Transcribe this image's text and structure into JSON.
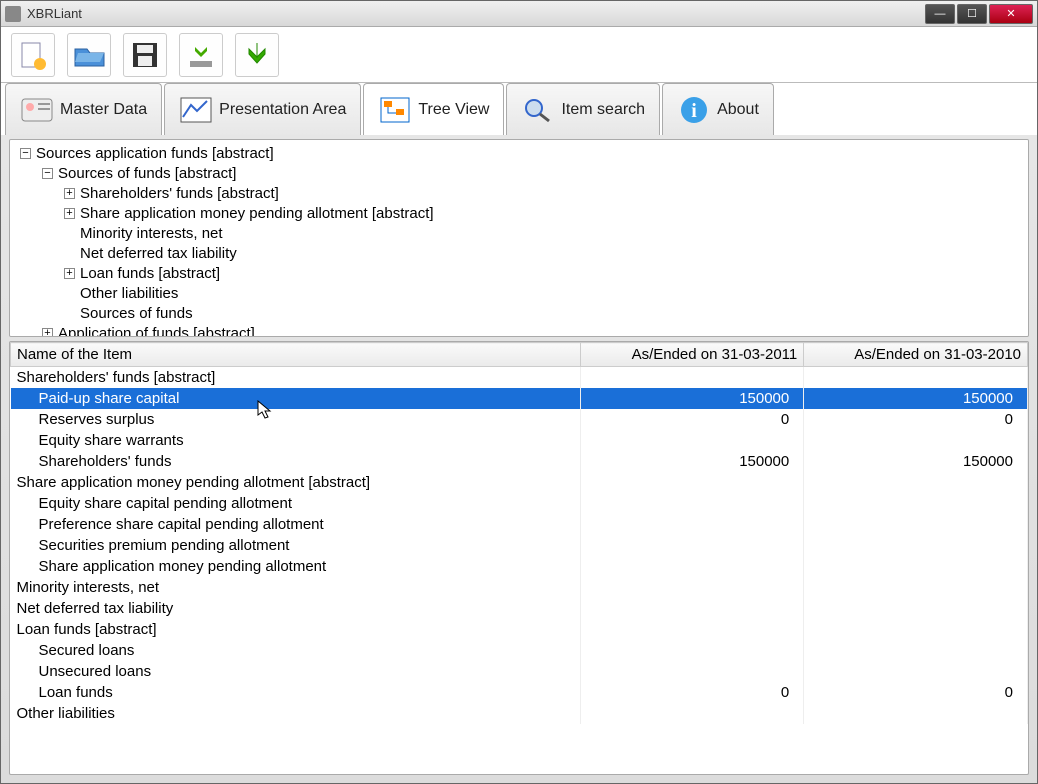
{
  "window": {
    "title": "XBRLiant"
  },
  "toolbar": {
    "buttons": [
      "new",
      "open",
      "save",
      "download",
      "refresh"
    ]
  },
  "tabs": {
    "items": [
      {
        "label": "Master Data"
      },
      {
        "label": "Presentation Area"
      },
      {
        "label": "Tree View"
      },
      {
        "label": "Item search"
      },
      {
        "label": "About"
      }
    ],
    "active": 2
  },
  "tree": {
    "n0": "Sources application funds [abstract]",
    "n1": "Sources of funds [abstract]",
    "n2": "Shareholders' funds [abstract]",
    "n3": "Share application money pending allotment [abstract]",
    "n4": "Minority interests, net",
    "n5": "Net deferred tax liability",
    "n6": "Loan funds [abstract]",
    "n7": "Other liabilities",
    "n8": "Sources of funds",
    "n9": "Application of funds [abstract]"
  },
  "grid": {
    "columns": {
      "c0": "Name of the Item",
      "c1": "As/Ended on 31-03-2011",
      "c2": "As/Ended on 31-03-2010"
    },
    "rows": [
      {
        "name": "Shareholders' funds [abstract]",
        "indent": 0,
        "v1": "",
        "v2": ""
      },
      {
        "name": "Paid-up share capital",
        "indent": 1,
        "v1": "150000",
        "v2": "150000",
        "selected": true
      },
      {
        "name": "Reserves surplus",
        "indent": 1,
        "v1": "0",
        "v2": "0"
      },
      {
        "name": "Equity share warrants",
        "indent": 1,
        "v1": "",
        "v2": ""
      },
      {
        "name": "Shareholders' funds",
        "indent": 1,
        "v1": "150000",
        "v2": "150000"
      },
      {
        "name": "Share application money pending allotment [abstract]",
        "indent": 0,
        "v1": "",
        "v2": ""
      },
      {
        "name": "Equity share capital pending allotment",
        "indent": 1,
        "v1": "",
        "v2": ""
      },
      {
        "name": "Preference share capital pending allotment",
        "indent": 1,
        "v1": "",
        "v2": ""
      },
      {
        "name": "Securities premium pending allotment",
        "indent": 1,
        "v1": "",
        "v2": ""
      },
      {
        "name": "Share application money pending allotment",
        "indent": 1,
        "v1": "",
        "v2": ""
      },
      {
        "name": "Minority interests, net",
        "indent": 0,
        "v1": "",
        "v2": ""
      },
      {
        "name": "Net deferred tax liability",
        "indent": 0,
        "v1": "",
        "v2": ""
      },
      {
        "name": "Loan funds [abstract]",
        "indent": 0,
        "v1": "",
        "v2": ""
      },
      {
        "name": "Secured loans",
        "indent": 1,
        "v1": "",
        "v2": ""
      },
      {
        "name": "Unsecured loans",
        "indent": 1,
        "v1": "",
        "v2": ""
      },
      {
        "name": "Loan funds",
        "indent": 1,
        "v1": "0",
        "v2": "0"
      },
      {
        "name": "Other liabilities",
        "indent": 0,
        "v1": "",
        "v2": ""
      }
    ]
  }
}
